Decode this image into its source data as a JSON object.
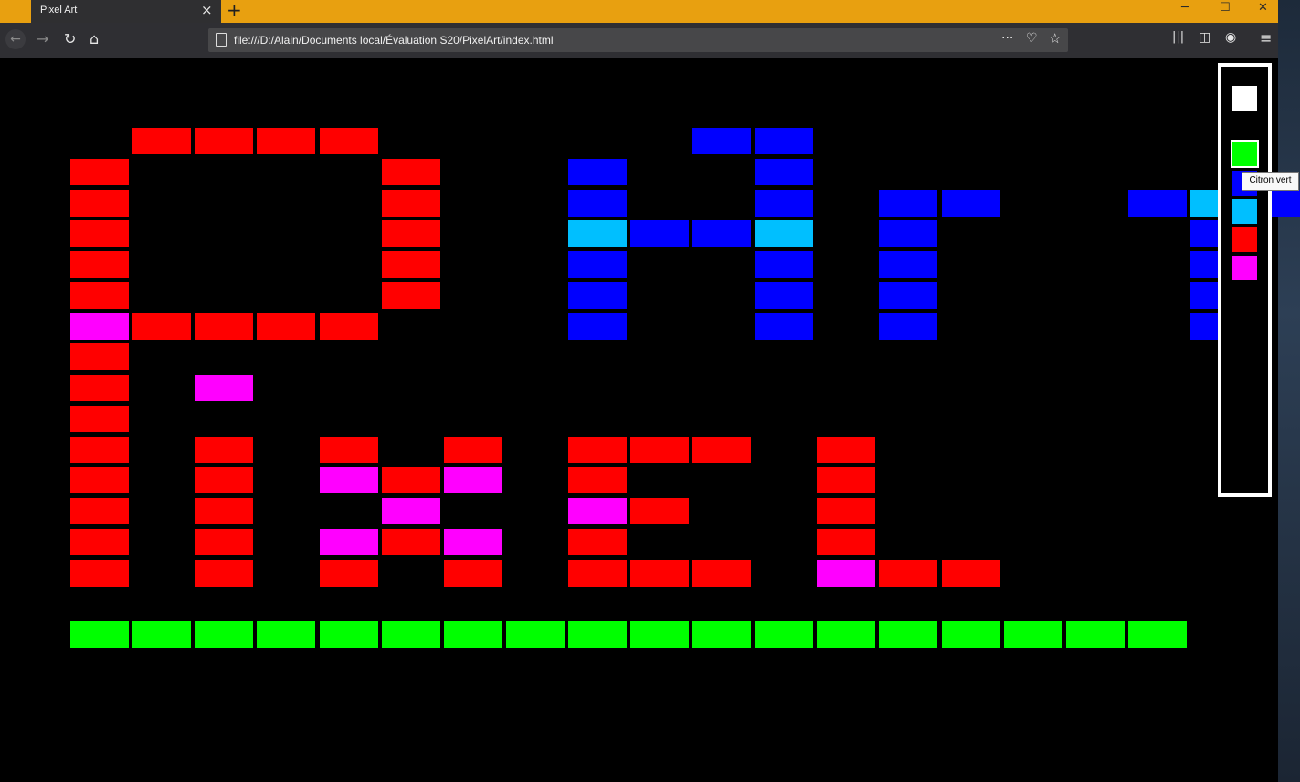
{
  "browser": {
    "tab_title": "Pixel Art",
    "tab_close": "×",
    "new_tab": "+",
    "url": "file:///D:/Alain/Documents local/Évaluation S20/PixelArt/index.html",
    "page_actions": "···",
    "back_icon": "arrow-left-icon",
    "forward_icon": "arrow-right-icon",
    "reload_icon": "reload-icon",
    "home_icon": "home-icon"
  },
  "window": {
    "minimize": "─",
    "maximize": "☐",
    "close": "✕"
  },
  "palette": {
    "colors": [
      {
        "name": "white",
        "hex": "#ffffff"
      },
      {
        "name": "lime",
        "hex": "#00ff00",
        "selected": true
      },
      {
        "name": "blue",
        "hex": "#0000ff"
      },
      {
        "name": "cyan",
        "hex": "#00bfff"
      },
      {
        "name": "red",
        "hex": "#ff0000"
      },
      {
        "name": "magenta",
        "hex": "#ff00ff"
      }
    ],
    "tooltip": "Citron vert"
  },
  "canvas": {
    "colors": {
      "R": "#ff0000",
      "B": "#0000ff",
      "C": "#00bfff",
      "M": "#ff00ff",
      "G": "#00ff00"
    },
    "grid": [
      "..RRRR.....BB........",
      ".R....R..B..B........",
      ".R....R..B..B.BB..BCB",
      ".R....R..CBBC.B....B.",
      ".R....R..B..B.B....B.",
      ".R....R..B..B.B....B.",
      ".MRRRR...B..B.B....B.",
      ".R...................",
      ".R.M.................",
      ".R...................",
      ".R.R.R.R.RRR.R.......",
      ".R.R.MRM.R...R.......",
      ".R.R..M..MR..R.......",
      ".R.R.MRM.R...R.......",
      ".R.R.R.R.RRR.MRR.....",
      ".....................",
      ".GGGGGGGGGGGGGGGGGG.."
    ]
  }
}
